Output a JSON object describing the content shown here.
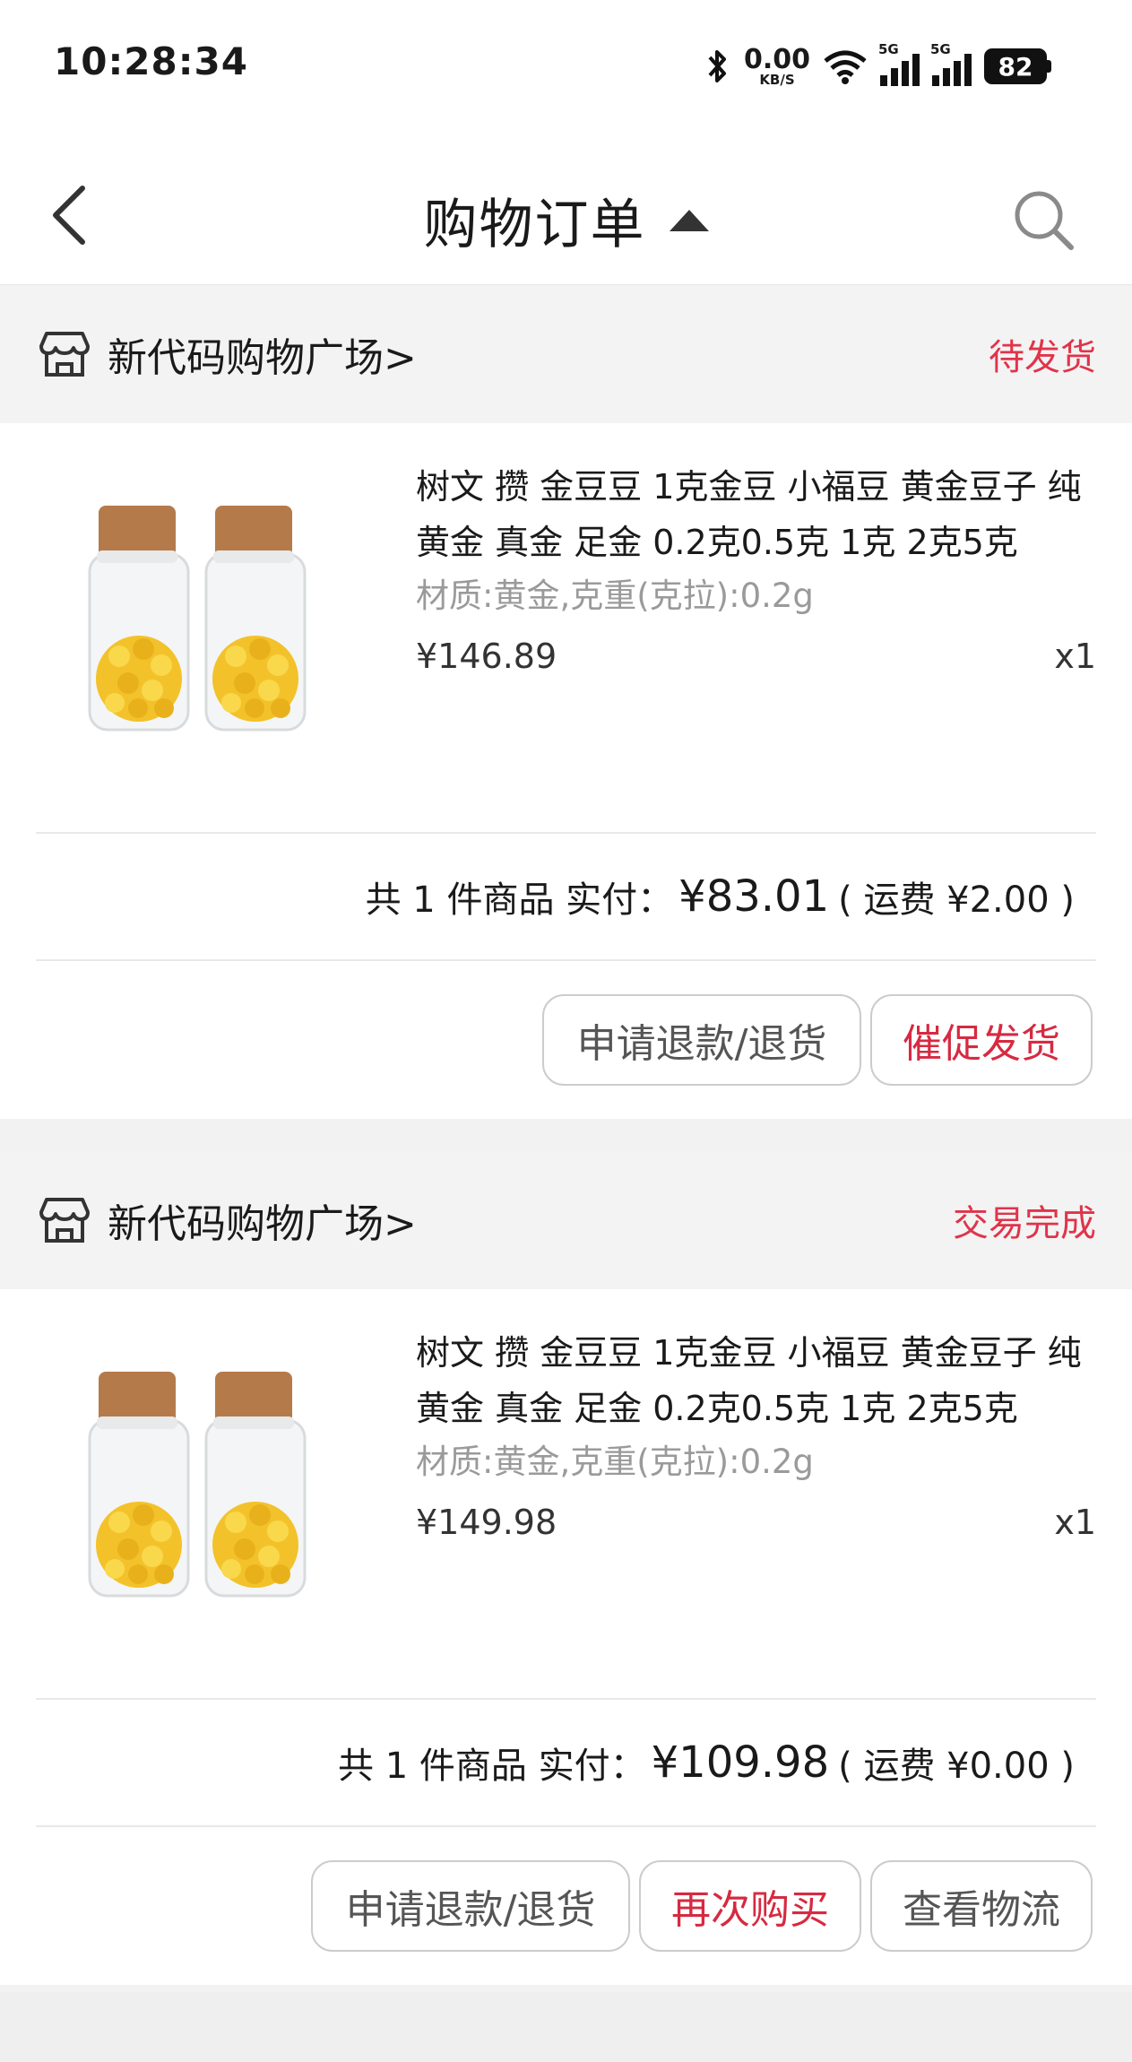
{
  "status_bar": {
    "time": "10:28:34",
    "net_speed_value": "0.00",
    "net_speed_unit": "KB/S",
    "sim1_label": "5G",
    "sim2_label": "5G",
    "battery": "82"
  },
  "header": {
    "title": "购物订单"
  },
  "orders": [
    {
      "shop_name": "新代码购物广场>",
      "status": "待发货",
      "product_title": "树文 攒 金豆豆 1克金豆 小福豆 黄金豆子 纯黄金 真金 足金 0.2克0.5克 1克 2克5克",
      "spec": "材质:黄金,克重(克拉):0.2g",
      "price": "¥146.89",
      "qty": "x1",
      "summary_count": "共 1 件商品 实付：",
      "summary_amount": "¥83.01",
      "summary_shipping": "( 运费 ¥2.00 )",
      "buttons": [
        "申请退款/退货",
        "催促发货"
      ]
    },
    {
      "shop_name": "新代码购物广场>",
      "status": "交易完成",
      "product_title": "树文 攒 金豆豆 1克金豆 小福豆 黄金豆子 纯黄金 真金 足金 0.2克0.5克 1克 2克5克",
      "spec": "材质:黄金,克重(克拉):0.2g",
      "price": "¥149.98",
      "qty": "x1",
      "summary_count": "共 1 件商品 实付：",
      "summary_amount": "¥109.98",
      "summary_shipping": "( 运费 ¥0.00 )",
      "buttons": [
        "申请退款/退货",
        "再次购买",
        "查看物流"
      ]
    }
  ],
  "colors": {
    "accent": "#e0344a",
    "muted": "#9a9a9a",
    "background": "#f2f2f2"
  }
}
